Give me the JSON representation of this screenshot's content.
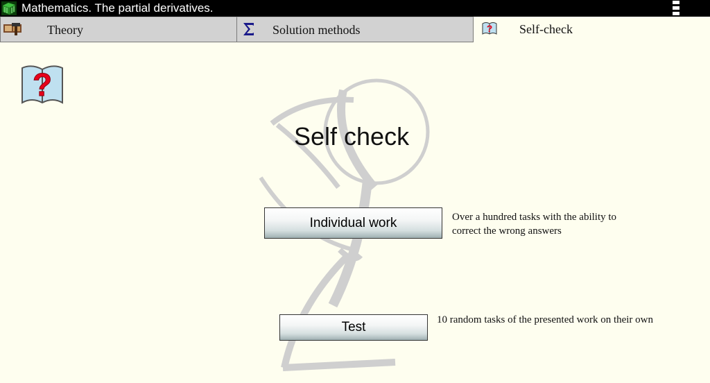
{
  "window": {
    "title": "Mathematics. The partial derivatives.",
    "app_icon": "cube-app-icon",
    "menu_icon": "kebab-menu-icon"
  },
  "tabs": [
    {
      "label": "Theory",
      "icon": "hammer-book-icon",
      "active": false
    },
    {
      "label": "Solution methods",
      "icon": "sigma-icon",
      "active": false
    },
    {
      "label": "Self-check",
      "icon": "question-book-icon",
      "active": true
    }
  ],
  "page": {
    "icon": "question-book-icon",
    "heading": "Self check",
    "options": [
      {
        "button_label": "Individual work",
        "description": "Over a hundred tasks with the ability to correct the wrong answers"
      },
      {
        "button_label": "Test",
        "description": "10 random tasks of the presented work on their own"
      }
    ]
  },
  "colors": {
    "background": "#fefeef",
    "titlebar": "#000000",
    "tab_inactive": "#d2d2d2",
    "watermark": "#cfcfcf",
    "icon_red": "#e8001a"
  }
}
